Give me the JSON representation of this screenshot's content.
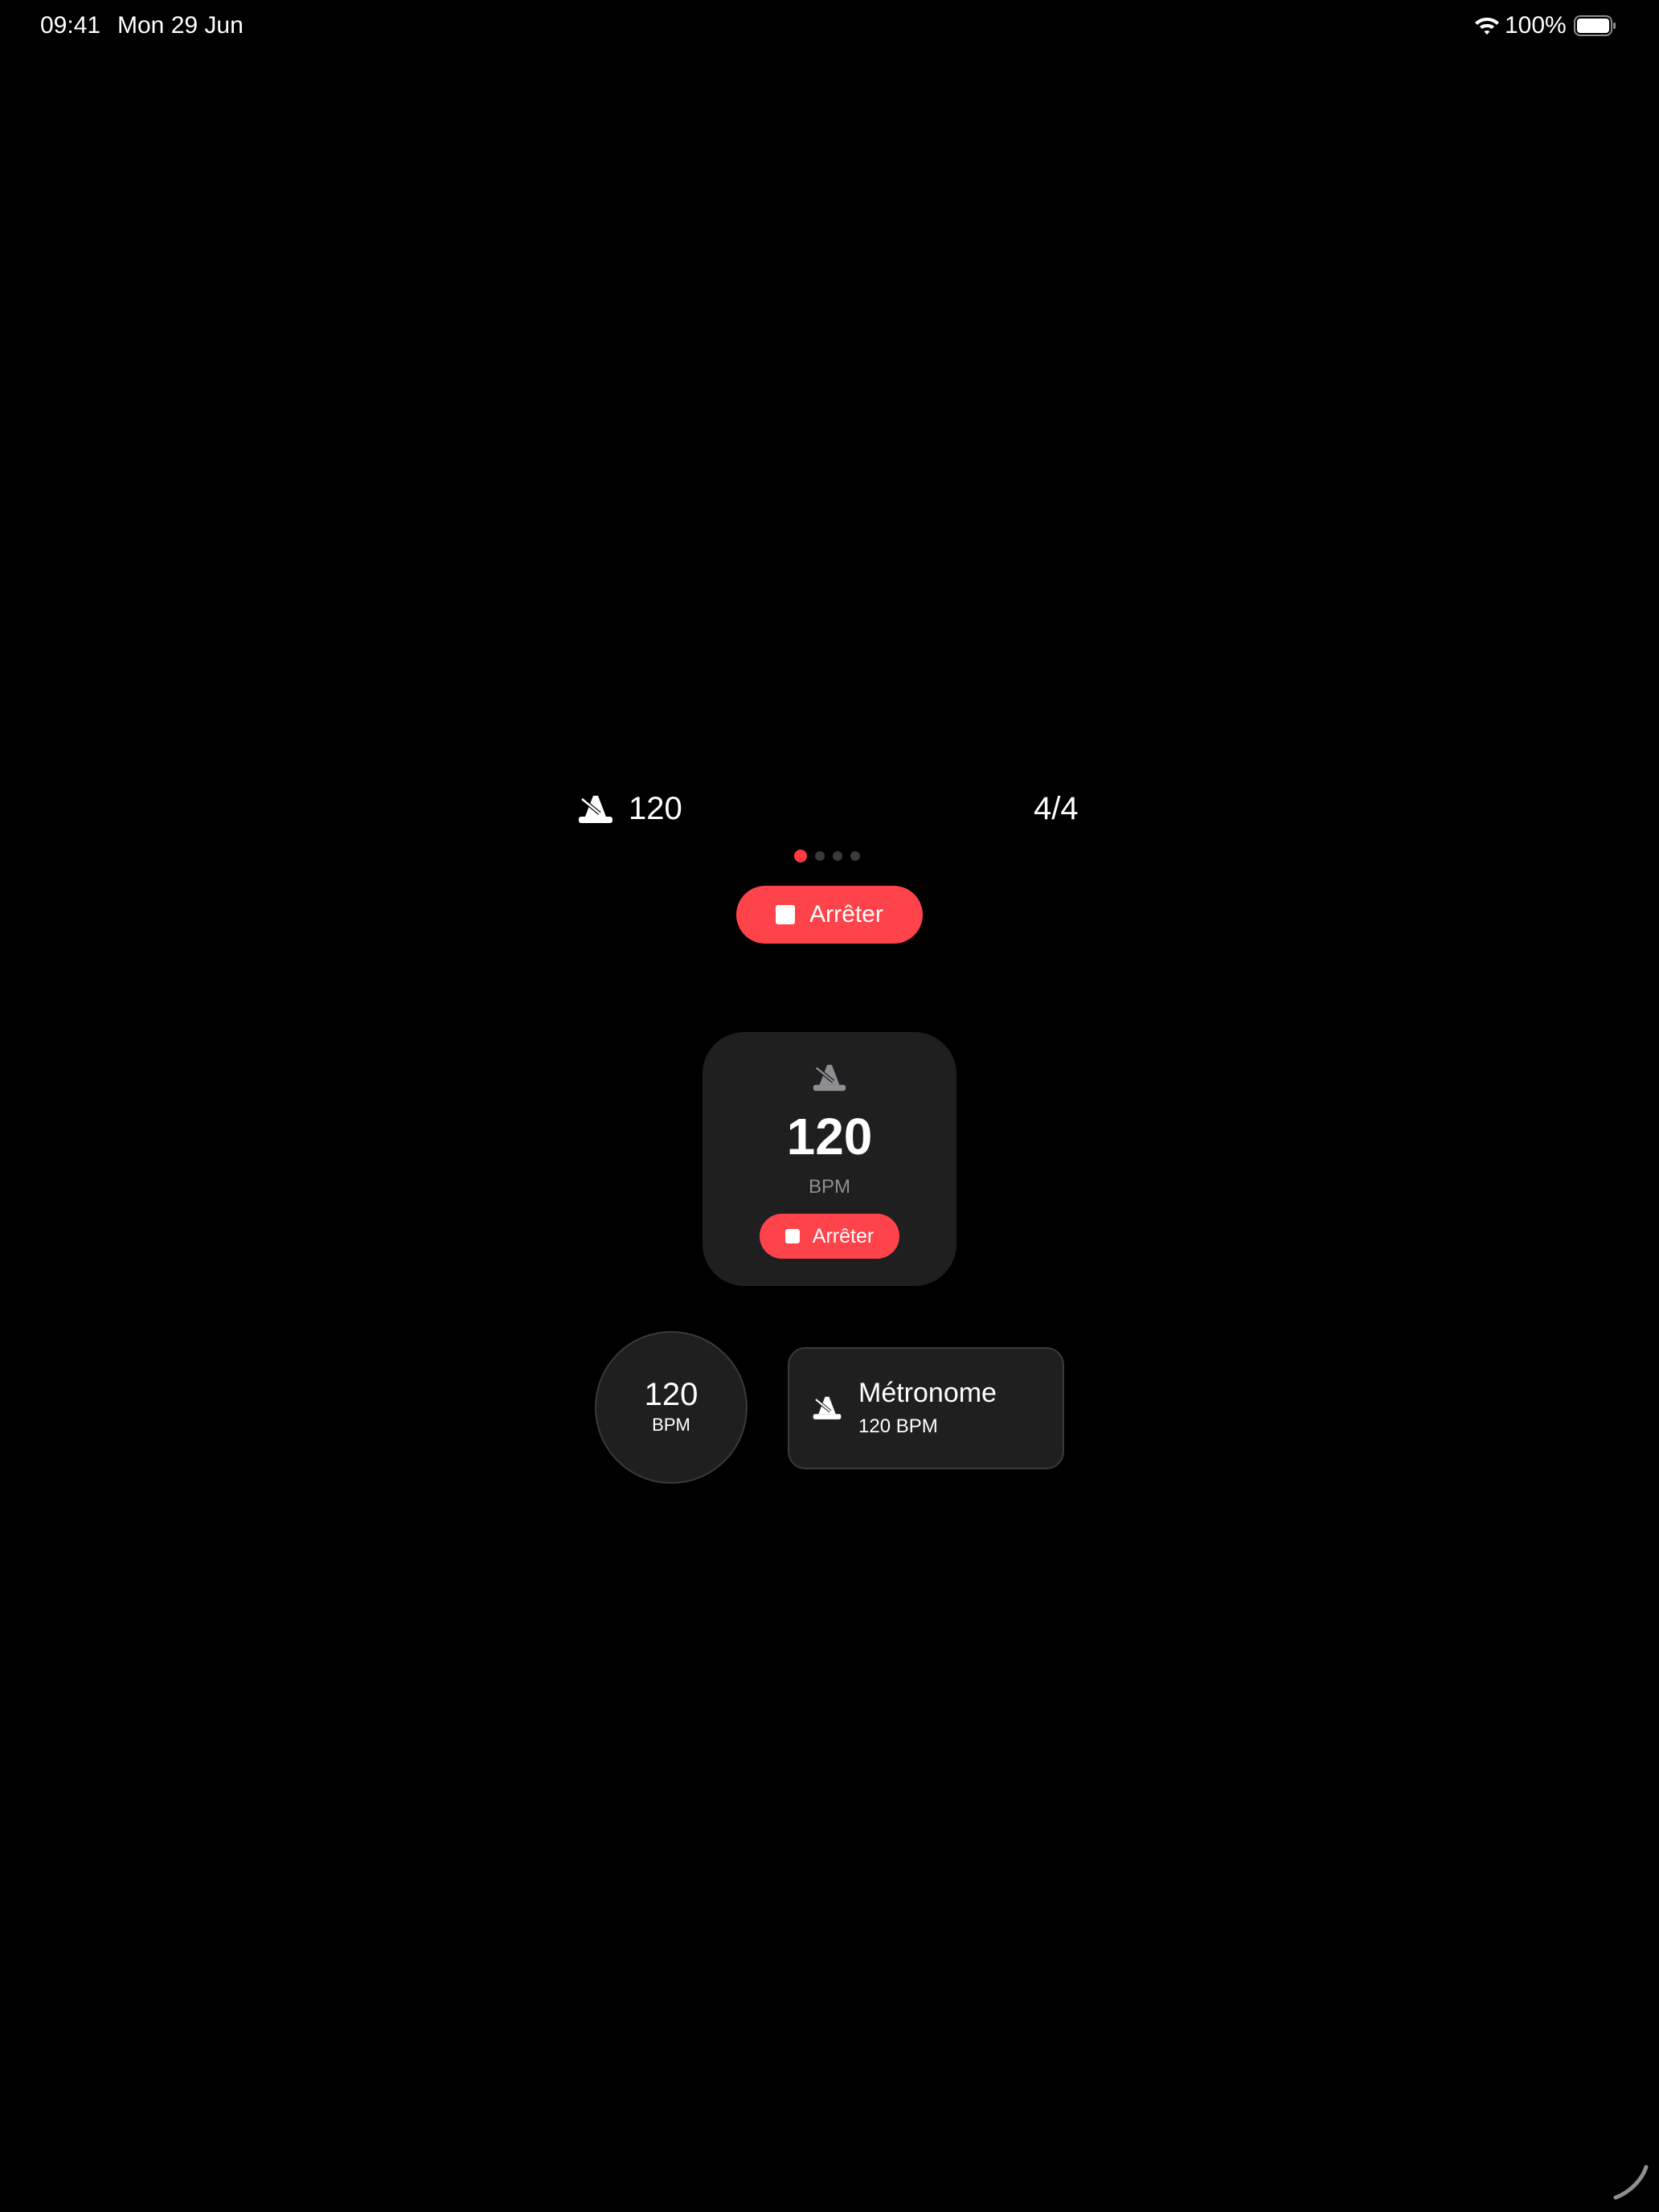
{
  "status_bar": {
    "time": "09:41",
    "date": "Mon 29 Jun",
    "battery": "100%",
    "wifi_icon": "wifi-icon",
    "battery_icon": "battery-icon"
  },
  "live_activity": {
    "icon": "metronome-icon",
    "bpm": "120",
    "time_signature": "4/4",
    "page_dots": {
      "count": 4,
      "active": 0
    },
    "stop_label": "Arrêter"
  },
  "widget_square": {
    "icon": "metronome-icon",
    "bpm": "120",
    "unit": "BPM",
    "stop_label": "Arrêter"
  },
  "widget_circle": {
    "bpm": "120",
    "unit": "BPM"
  },
  "widget_rect": {
    "icon": "metronome-icon",
    "title": "Métronome",
    "subtitle": "120 BPM"
  },
  "colors": {
    "accent": "#ff434a",
    "card": "#1f1f1f",
    "background": "#000000"
  }
}
